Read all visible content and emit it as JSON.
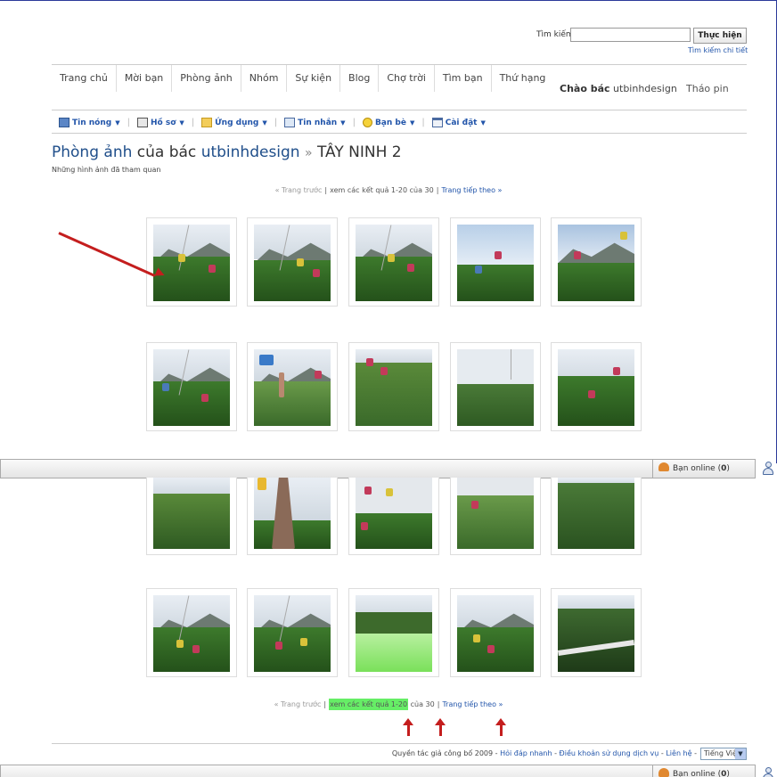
{
  "search": {
    "label": "Tìm kiếm",
    "value": "",
    "button": "Thực hiện",
    "advanced": "Tìm kiếm chi tiết"
  },
  "nav": {
    "items": [
      "Trang chủ",
      "Mời bạn",
      "Phòng ảnh",
      "Nhóm",
      "Sự kiện",
      "Blog",
      "Chợ trời",
      "Tìm bạn",
      "Thứ hạng"
    ],
    "greeting_prefix": "Chào bác",
    "username": "utbinhdesign",
    "logout": "Tháo pin"
  },
  "toolbar": {
    "items": [
      {
        "label": "Tin nóng",
        "icon": "news-icon"
      },
      {
        "label": "Hồ sơ",
        "icon": "profile-card-icon"
      },
      {
        "label": "Ứng dụng",
        "icon": "folder-icon"
      },
      {
        "label": "Tin nhắn",
        "icon": "envelope-icon"
      },
      {
        "label": "Bạn bè",
        "icon": "smiley-icon"
      },
      {
        "label": "Cài đặt",
        "icon": "settings-window-icon"
      }
    ]
  },
  "header": {
    "title_link": "Phòng ảnh",
    "title_mid": "của bác",
    "title_user": "utbinhdesign",
    "title_sep": "»",
    "album": "TÂY NINH 2",
    "subtitle": "Những hình ảnh đã tham quan"
  },
  "pager": {
    "prev": "« Trang trước",
    "sep": "|",
    "results_a": "xem các kết quả 1-20",
    "results_b": "của 30",
    "next": "Trang tiếp theo »"
  },
  "online": {
    "label": "Bạn online",
    "count": "0"
  },
  "footer": {
    "copyright": "Quyền tác giả công bố 2009",
    "dash": "-",
    "links": [
      "Hỏi đáp nhanh",
      "Điều khoản sử dụng dịch vụ",
      "Liên hệ"
    ],
    "language": "Tiếng Việt"
  },
  "colors": {
    "link": "#2255aa",
    "title_link": "#1f4e8a",
    "highlight": "#66ee66",
    "annotation": "#c41e1e",
    "border": "#2b3a9a"
  }
}
